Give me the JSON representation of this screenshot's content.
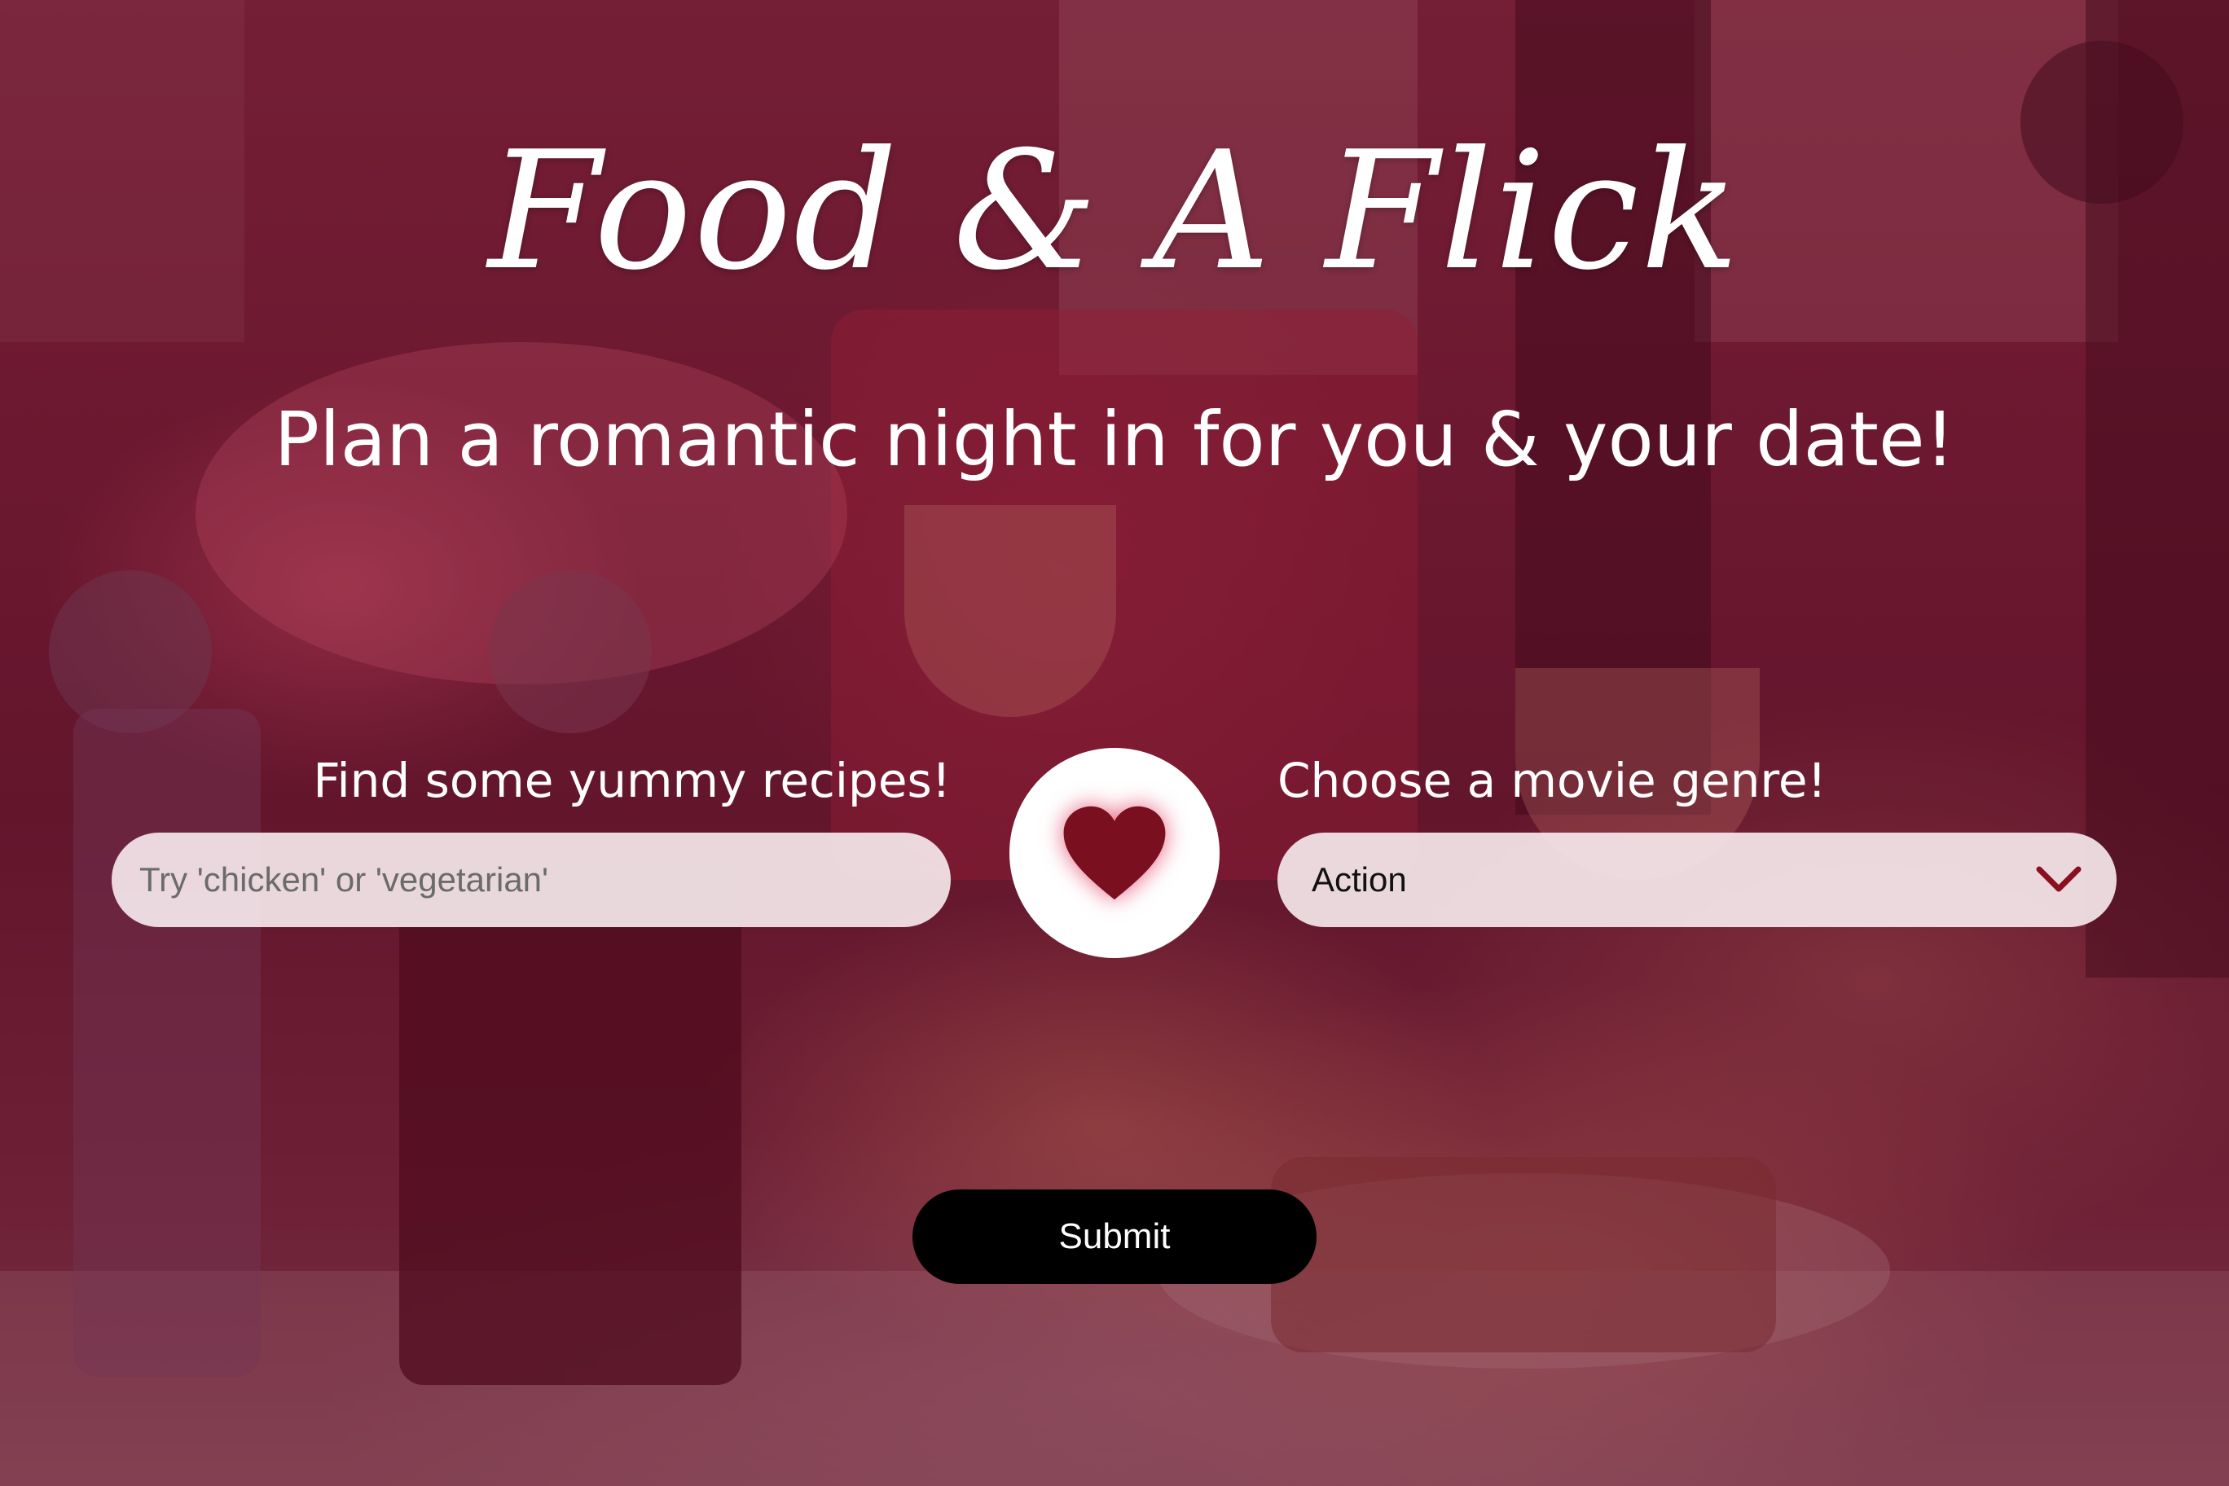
{
  "header": {
    "title": "Food & A Flick",
    "subtitle": "Plan a romantic night in for you & your date!"
  },
  "recipes": {
    "label": "Find some yummy recipes!",
    "placeholder": "Try 'chicken' or 'vegetarian'",
    "value": ""
  },
  "movies": {
    "label": "Choose a movie genre!",
    "selected": "Action"
  },
  "submit": {
    "label": "Submit"
  },
  "colors": {
    "accent": "#7a0f1f",
    "overlay": "#6e0f2d",
    "button": "#000000"
  },
  "icons": {
    "center": "heart-icon",
    "dropdown": "chevron-down-icon"
  }
}
